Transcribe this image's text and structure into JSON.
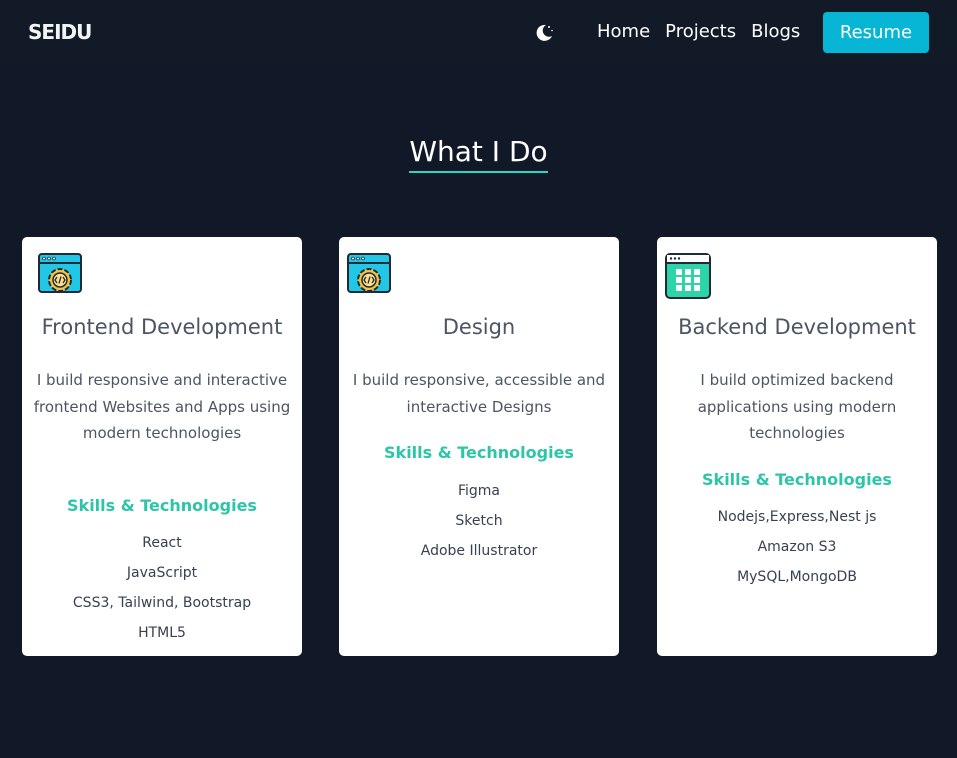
{
  "navbar": {
    "logo": "SEIDU",
    "theme_toggle_icon": "moon-icon",
    "links": [
      "Home",
      "Projects",
      "Blogs"
    ],
    "resume_label": "Resume",
    "accent_color": "#06b6d4"
  },
  "section": {
    "title": "What I Do"
  },
  "cards": [
    {
      "icon": "code-window-gear-icon",
      "title": "Frontend Development",
      "description": "I build responsive and interactive frontend Websites and Apps using modern technologies",
      "skills_heading": "Skills & Technologies",
      "skills": [
        "React",
        "JavaScript",
        "CSS3, Tailwind, Bootstrap",
        "HTML5"
      ]
    },
    {
      "icon": "code-window-gear-icon",
      "title": "Design",
      "description": "I build responsive, accessible and interactive Designs",
      "skills_heading": "Skills & Technologies",
      "skills": [
        "Figma",
        "Sketch",
        "Adobe Illustrator"
      ]
    },
    {
      "icon": "server-grid-icon",
      "title": "Backend Development",
      "description": "I build optimized backend applications using modern technologies",
      "skills_heading": "Skills & Technologies",
      "skills": [
        "Nodejs,Express,Nest js",
        "Amazon S3",
        "MySQL,MongoDB"
      ]
    }
  ],
  "colors": {
    "background": "#111827",
    "skills_heading": "#2dc5a8",
    "title_underline": "#2dd4bf"
  }
}
